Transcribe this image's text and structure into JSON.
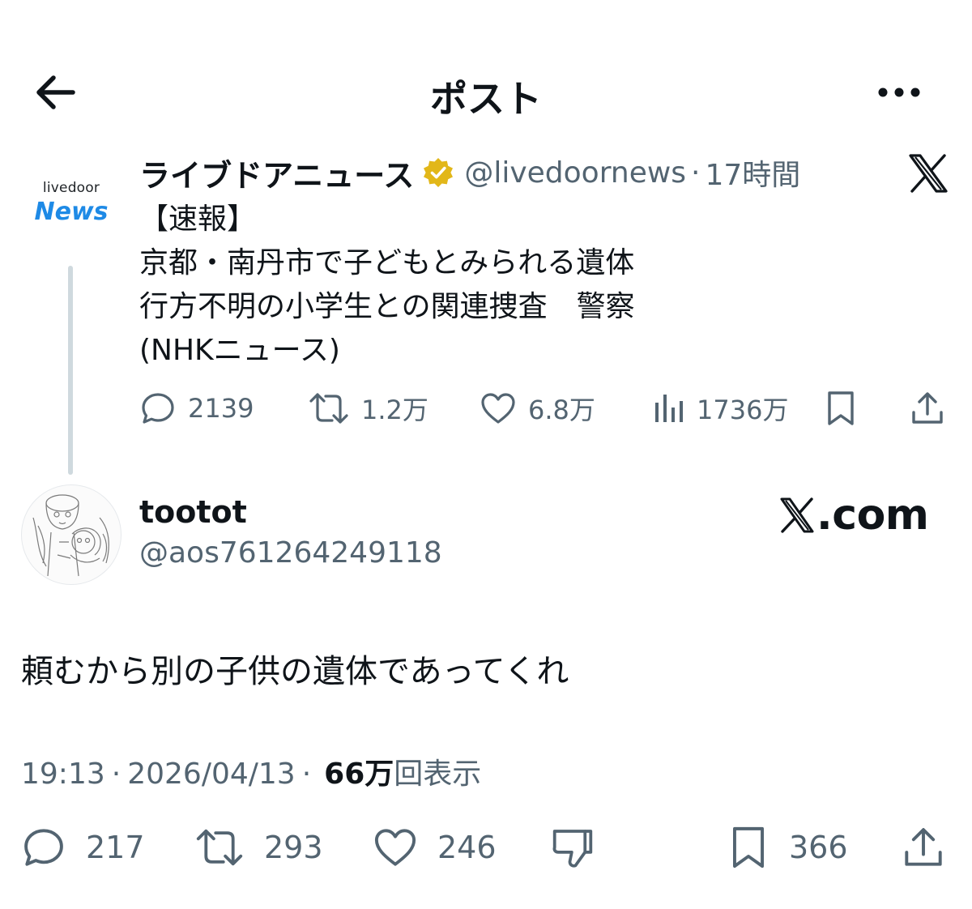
{
  "header": {
    "title": "ポスト",
    "back_icon": "arrow-left-icon",
    "more_icon": "more-horizontal-icon"
  },
  "quoted": {
    "logo": {
      "line1": "livedoor",
      "line2": "News"
    },
    "name": "ライブドアニュース",
    "handle": "@livedoornews",
    "dot": "·",
    "time": "17時間",
    "verified_color": "#e2b719",
    "text_lines": [
      "【速報】",
      "京都・南丹市で子どもとみられる遺体",
      "行方不明の小学生との関連捜査　警察",
      "(NHKニュース)"
    ],
    "actions": {
      "replies": "2139",
      "reposts": "1.2万",
      "likes": "6.8万",
      "views": "1736万"
    }
  },
  "post": {
    "name": "tootot",
    "handle": "@aos761264249118",
    "brand": {
      "dotcom": ".com"
    },
    "text": "頼むから別の子供の遺体であってくれ",
    "meta": {
      "time": "19:13",
      "sep1": "·",
      "date": "2026/04/13",
      "sep2": "·",
      "views_count": "66万",
      "views_label": "回表示"
    },
    "actions": {
      "replies": "217",
      "reposts": "293",
      "likes": "246",
      "bookmarks": "366"
    }
  },
  "colors": {
    "text": "#0f1419",
    "muted": "#536471",
    "thread_line": "#cfd9de",
    "livedoor_blue": "#1e8ae6"
  }
}
